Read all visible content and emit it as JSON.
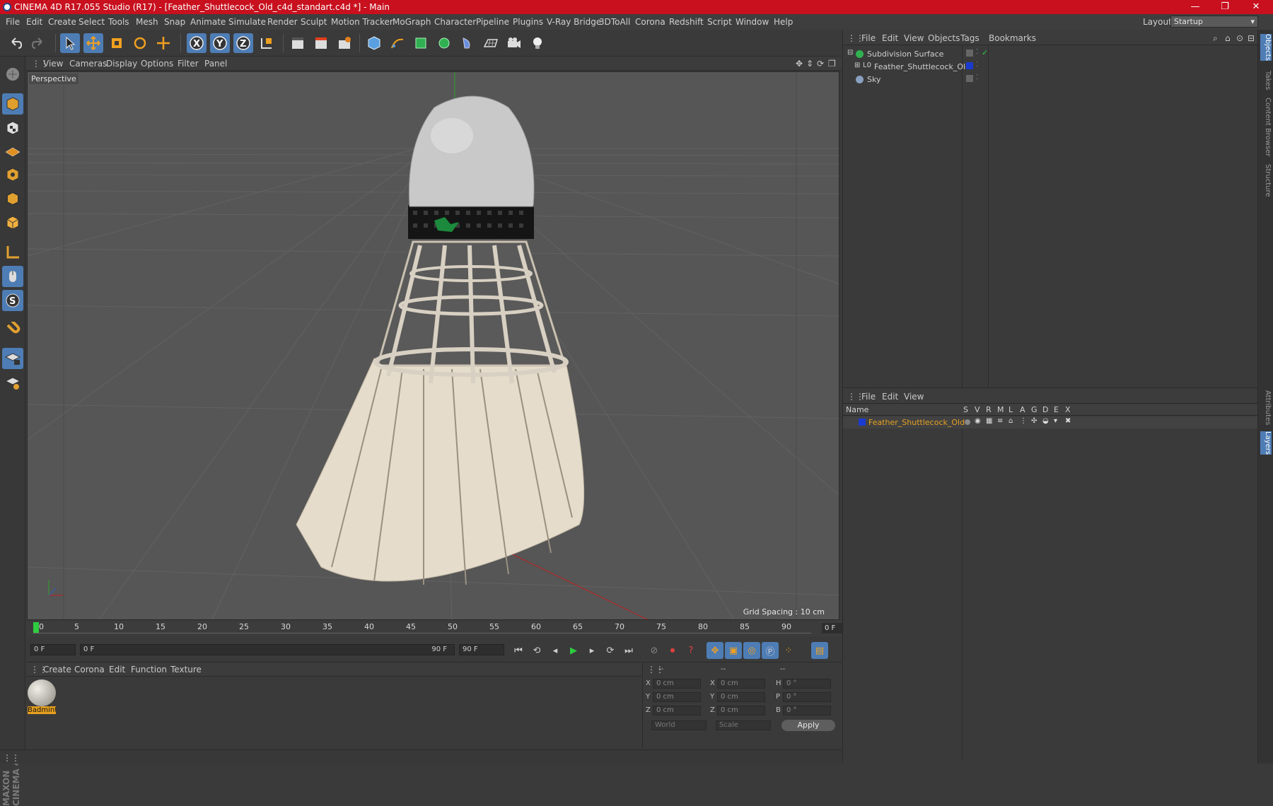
{
  "window": {
    "title": "CINEMA 4D R17.055 Studio (R17) - [Feather_Shuttlecock_Old_c4d_standart.c4d *] - Main",
    "minimize": "—",
    "maximize": "❐",
    "close": "✕"
  },
  "menubar": {
    "items": [
      "File",
      "Edit",
      "Create",
      "Select",
      "Tools",
      "Mesh",
      "Snap",
      "Animate",
      "Simulate",
      "Render",
      "Sculpt",
      "Motion Tracker",
      "MoGraph",
      "Character",
      "Pipeline",
      "Plugins",
      "V-Ray Bridge",
      "3DToAll",
      "Corona",
      "Redshift",
      "Script",
      "Window",
      "Help"
    ],
    "layout_label": "Layout:",
    "layout_value": "Startup"
  },
  "viewport": {
    "menu": [
      "View",
      "Cameras",
      "Display",
      "Options",
      "Filter",
      "Panel"
    ],
    "label": "Perspective",
    "grid_spacing": "Grid Spacing : 10 cm"
  },
  "timeline": {
    "ticks": [
      "0",
      "5",
      "10",
      "15",
      "20",
      "25",
      "30",
      "35",
      "40",
      "45",
      "50",
      "55",
      "60",
      "65",
      "70",
      "75",
      "80",
      "85",
      "90"
    ],
    "current_frame": "0 F"
  },
  "transport": {
    "start": "0 F",
    "range_start": "0 F",
    "range_end": "90 F",
    "end": "90 F"
  },
  "material_manager": {
    "menu": [
      "Create",
      "Corona",
      "Edit",
      "Function",
      "Texture"
    ],
    "materials": [
      {
        "name": "Badmint"
      }
    ]
  },
  "coordinates": {
    "headers": [
      "--",
      "--",
      "--"
    ],
    "rows": [
      {
        "a": "X",
        "av": "0 cm",
        "b": "X",
        "bv": "0 cm",
        "c": "H",
        "cv": "0 °"
      },
      {
        "a": "Y",
        "av": "0 cm",
        "b": "Y",
        "bv": "0 cm",
        "c": "P",
        "cv": "0 °"
      },
      {
        "a": "Z",
        "av": "0 cm",
        "b": "Z",
        "bv": "0 cm",
        "c": "B",
        "cv": "0 °"
      }
    ],
    "mode1": "World",
    "mode2": "Scale",
    "apply": "Apply"
  },
  "object_manager": {
    "menu": [
      "File",
      "Edit",
      "View",
      "Objects",
      "Tags",
      "Bookmarks"
    ],
    "objects": [
      {
        "name": "Subdivision Surface"
      },
      {
        "name": "Feather_Shuttlecock_Old"
      },
      {
        "name": "Sky"
      }
    ]
  },
  "attribute_manager": {
    "menu": [
      "File",
      "Edit",
      "View"
    ],
    "columns": [
      "Name",
      "S",
      "V",
      "R",
      "M",
      "L",
      "A",
      "G",
      "D",
      "E",
      "X"
    ],
    "layer_name": "Feather_Shuttlecock_Old"
  },
  "side_tabs": [
    "Objects",
    "Takes",
    "Content Browser",
    "Structure",
    "Attributes",
    "Layers"
  ],
  "branding": {
    "logo": "MAXON CINEMA 4D"
  },
  "colors": {
    "accent": "#4e7db5",
    "title_bar": "#c8101e",
    "layer_highlight": "#e6a020"
  }
}
